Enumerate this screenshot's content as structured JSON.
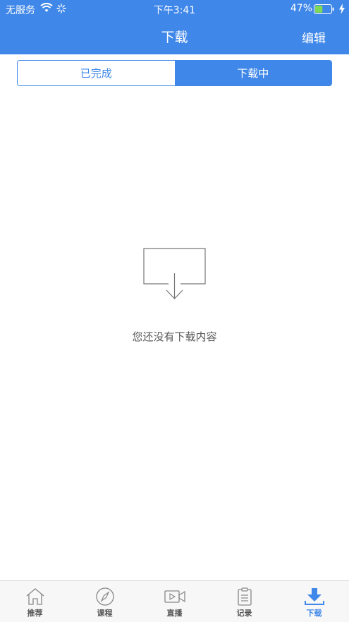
{
  "status_bar": {
    "carrier": "无服务",
    "time": "下午3:41",
    "battery_percent": "47%",
    "battery_level": 0.47
  },
  "nav": {
    "title": "下载",
    "edit_label": "编辑"
  },
  "segments": [
    {
      "label": "已完成",
      "selected": false
    },
    {
      "label": "下载中",
      "selected": true
    }
  ],
  "empty_state": {
    "text": "您还没有下载内容",
    "icon": "download-tray-icon"
  },
  "tabbar": [
    {
      "label": "推荐",
      "icon": "home-icon",
      "active": false
    },
    {
      "label": "课程",
      "icon": "compass-icon",
      "active": false
    },
    {
      "label": "直播",
      "icon": "video-camera-icon",
      "active": false
    },
    {
      "label": "记录",
      "icon": "clipboard-icon",
      "active": false
    },
    {
      "label": "下载",
      "icon": "download-icon",
      "active": true
    }
  ],
  "colors": {
    "accent": "#3f87e8",
    "tab_inactive": "#555555",
    "empty_text": "#555555"
  }
}
